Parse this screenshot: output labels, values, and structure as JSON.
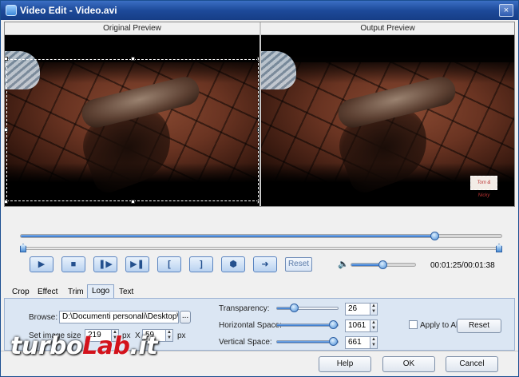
{
  "window": {
    "title": "Video Edit - Video.avi",
    "close": "×"
  },
  "preview": {
    "original_label": "Original Preview",
    "output_label": "Output Preview",
    "logo_text": "Tom & Nicky"
  },
  "player": {
    "buttons": [
      "▶",
      "■",
      "❚▶",
      "▶❚",
      "[",
      "]",
      "⬢",
      "➜"
    ],
    "reset_label": "Reset",
    "time": "00:01:25/00:01:38",
    "timeline_progress": 0.86,
    "volume": 0.5
  },
  "tabs": [
    "Crop",
    "Effect",
    "Trim",
    "Logo",
    "Text"
  ],
  "active_tab": "Logo",
  "logo_panel": {
    "browse_label": "Browse:",
    "browse_value": "D:\\Documenti personali\\Desktop\\Logo",
    "browse_button": "...",
    "set_size_label": "Set image size",
    "width_value": "219",
    "px1": "px",
    "x_label": "X",
    "height_value": "59",
    "px2": "px",
    "transparency_label": "Transparency:",
    "transparency_value": "26",
    "transparency_level": 0.26,
    "hspace_label": "Horizontal Space:",
    "hspace_value": "1061",
    "vspace_label": "Vertical Space:",
    "vspace_value": "661",
    "apply_label": "Apply to All",
    "reset_label": "Reset"
  },
  "footer": {
    "help": "Help",
    "ok": "OK",
    "cancel": "Cancel"
  },
  "watermark": {
    "part1": "turbo",
    "part2": "Lab",
    "part3": ".it"
  }
}
